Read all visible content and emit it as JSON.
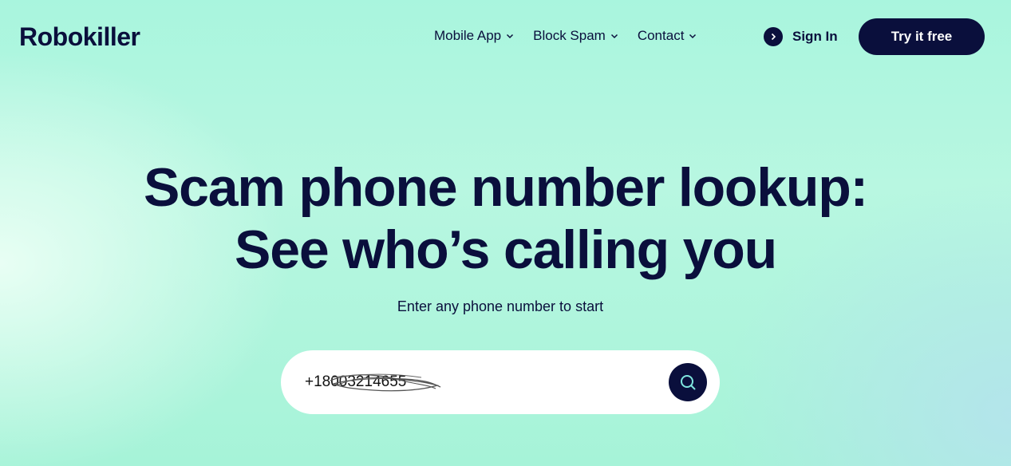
{
  "brand": {
    "logo_text": "Robokiller"
  },
  "nav": {
    "items": [
      {
        "label": "Mobile App",
        "icon": "chevron-down-icon"
      },
      {
        "label": "Block Spam",
        "icon": "chevron-down-icon"
      },
      {
        "label": "Contact",
        "icon": "chevron-down-icon"
      }
    ],
    "sign_in": {
      "label": "Sign In",
      "icon": "chevron-right-icon"
    },
    "cta": {
      "label": "Try it free"
    }
  },
  "hero": {
    "title_line1": "Scam phone number lookup:",
    "title_line2": "See who’s calling you",
    "subtitle": "Enter any phone number to start"
  },
  "search": {
    "value": "+18003214655",
    "button_icon": "search-icon"
  },
  "colors": {
    "navy": "#0a0f3c",
    "background": "#a9f5de",
    "input_bg": "#ffffff"
  }
}
